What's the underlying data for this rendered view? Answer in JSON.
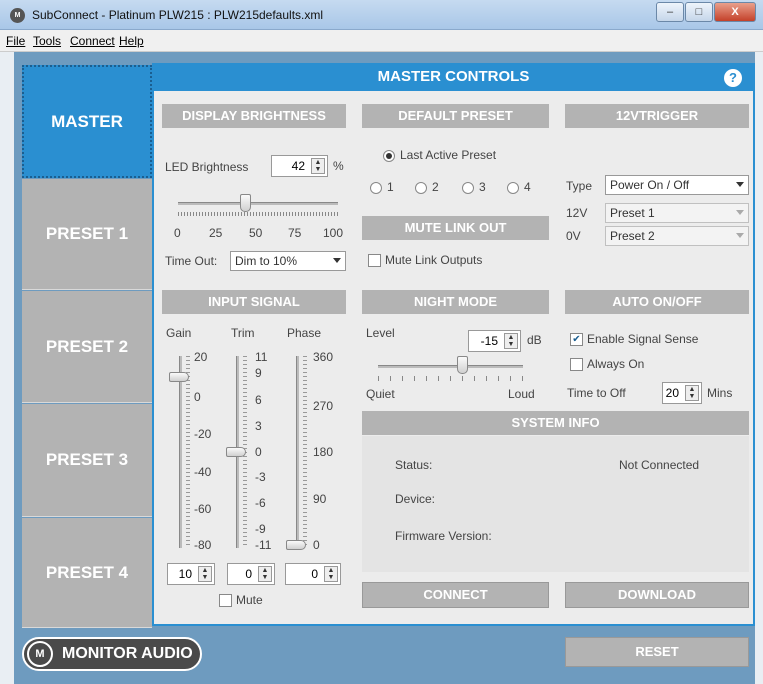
{
  "window": {
    "title": "SubConnect - Platinum PLW215 : PLW215defaults.xml",
    "icon": "app-logo-icon",
    "minimize": "–",
    "maximize": "□",
    "close": "X"
  },
  "menu": [
    "File",
    "Tools",
    "Connect",
    "Help"
  ],
  "tabs": [
    "MASTER",
    "PRESET 1",
    "PRESET 2",
    "PRESET 3",
    "PRESET 4"
  ],
  "panel": {
    "title": "MASTER CONTROLS",
    "help": "?"
  },
  "display_brightness": {
    "heading": "DISPLAY BRIGHTNESS",
    "led_label": "LED Brightness",
    "led_value": "42",
    "unit": "%",
    "slider_level_percent": 42,
    "scale": [
      "0",
      "25",
      "50",
      "75",
      "100"
    ],
    "timeout_label": "Time Out:",
    "timeout_value": "Dim to 10%"
  },
  "default_preset": {
    "heading": "DEFAULT PRESET",
    "last_active": "Last Active Preset",
    "options": [
      "1",
      "2",
      "3",
      "4"
    ]
  },
  "mute_link": {
    "heading": "MUTE LINK OUT",
    "label": "Mute Link Outputs"
  },
  "trigger": {
    "heading": "12VTRIGGER",
    "type_label": "Type",
    "type_value": "Power On / Off",
    "v12_label": "12V",
    "v12_value": "Preset 1",
    "v0_label": "0V",
    "v0_value": "Preset 2"
  },
  "input_signal": {
    "heading": "INPUT SIGNAL",
    "gain_label": "Gain",
    "trim_label": "Trim",
    "phase_label": "Phase",
    "gain_scale": [
      "20",
      "0",
      "-20",
      "-40",
      "-60",
      "-80"
    ],
    "trim_scale": [
      "11",
      "9",
      "6",
      "3",
      "0",
      "-3",
      "-6",
      "-9",
      "-11"
    ],
    "phase_scale": [
      "360",
      "270",
      "180",
      "90",
      "0"
    ],
    "gain_value": "10",
    "trim_value": "0",
    "phase_value": "0",
    "mute_label": "Mute"
  },
  "night_mode": {
    "heading": "NIGHT MODE",
    "level_label": "Level",
    "level_value": "-15",
    "unit": "dB",
    "quiet": "Quiet",
    "loud": "Loud"
  },
  "auto_onoff": {
    "heading": "AUTO ON/OFF",
    "signal_sense": "Enable Signal Sense",
    "always_on": "Always On",
    "time_label": "Time to Off",
    "time_value": "20",
    "unit": "Mins"
  },
  "system_info": {
    "heading": "SYSTEM INFO",
    "status_label": "Status:",
    "status_value": "Not Connected",
    "device_label": "Device:",
    "firmware_label": "Firmware Version:"
  },
  "buttons": {
    "connect": "CONNECT",
    "download": "DOWNLOAD",
    "reset": "RESET"
  },
  "logo": {
    "mark": "M",
    "text": "MONITOR AUDIO"
  },
  "colors": {
    "accent": "#2a8fd1",
    "section_gray": "#b3b3b3",
    "panel_bg": "#ececec"
  }
}
